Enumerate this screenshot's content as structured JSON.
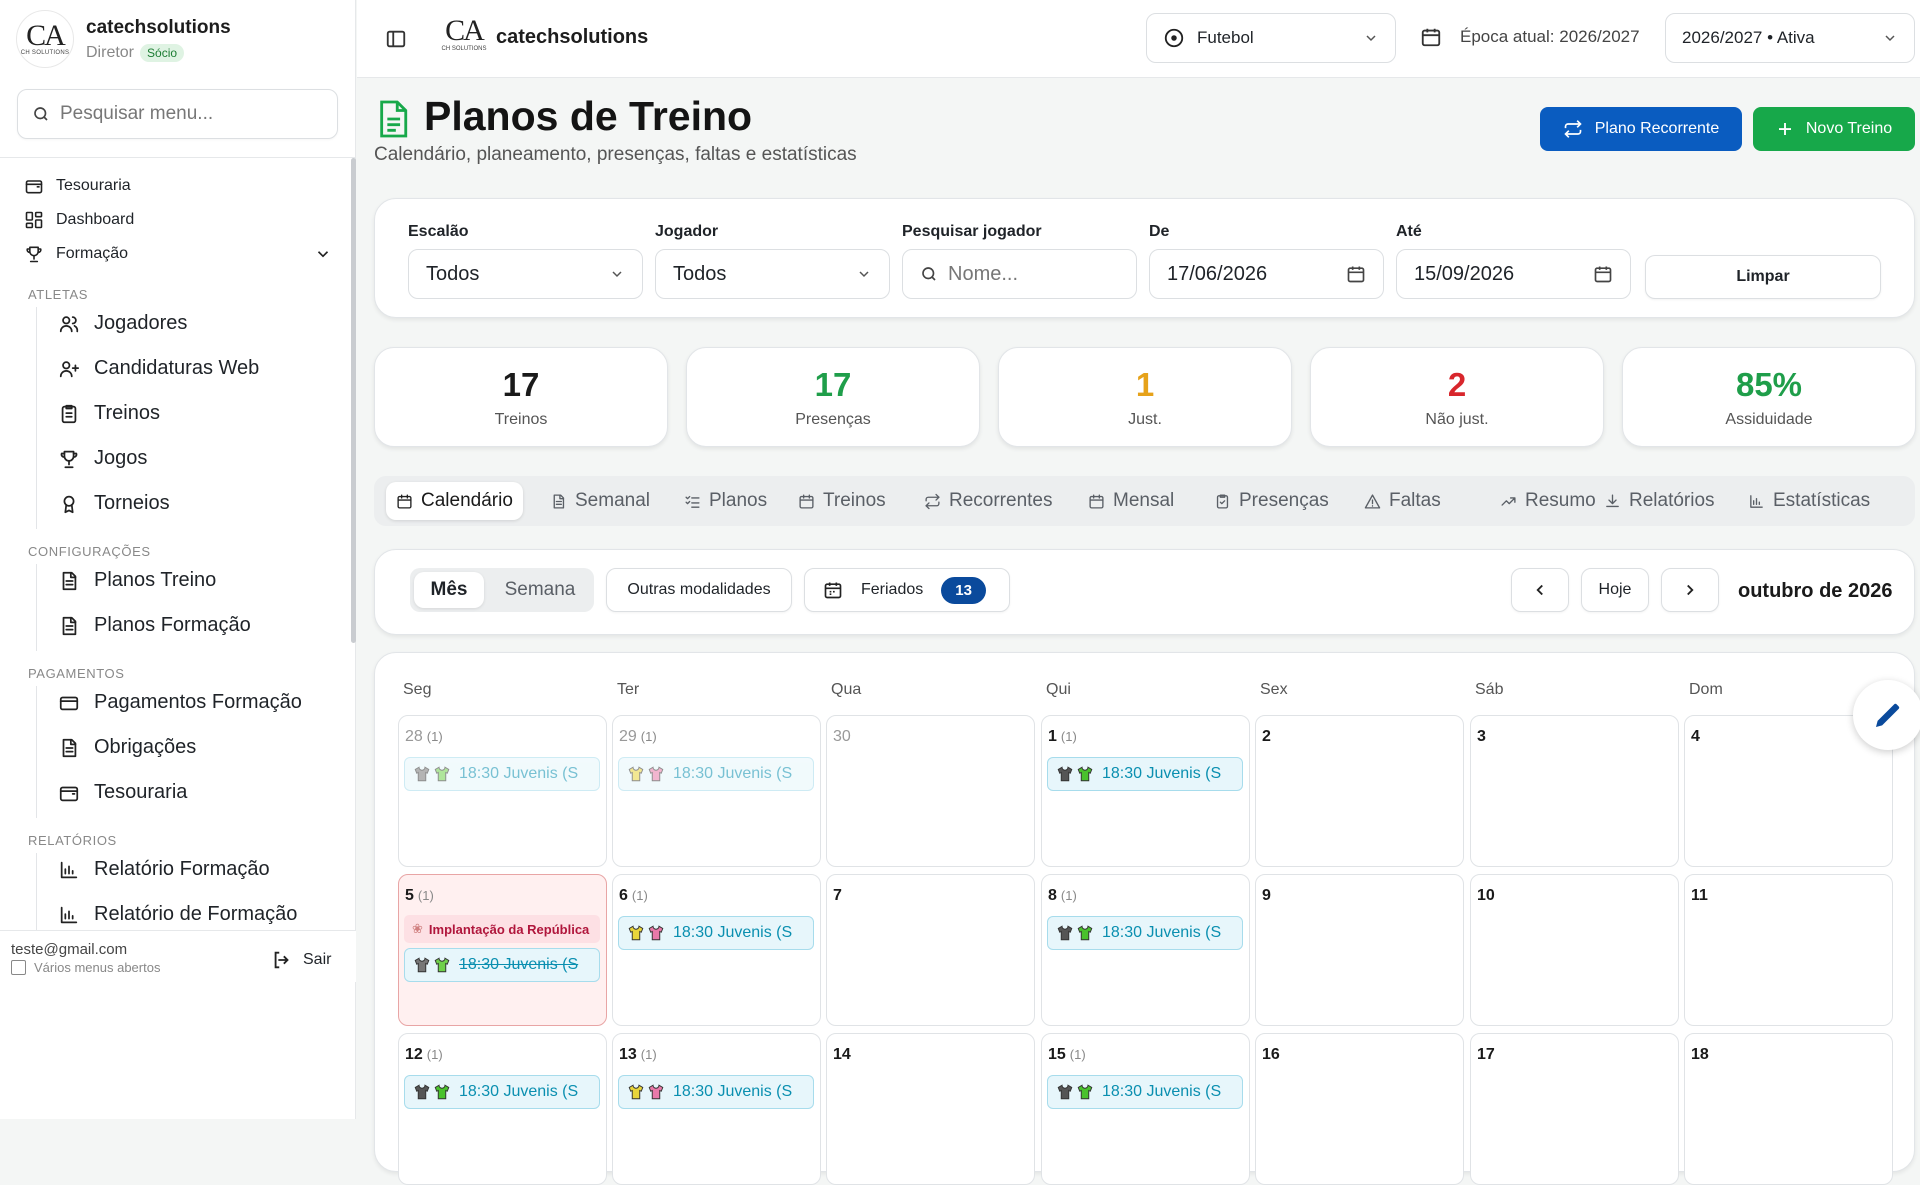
{
  "brand": {
    "name": "catechsolutions",
    "role": "Diretor",
    "badge": "Sócio",
    "logo_text": "CA",
    "logo_sub": "CH SOLUTIONS"
  },
  "sidebar": {
    "search_placeholder": "Pesquisar menu...",
    "top_items": [
      {
        "label": "Tesouraria",
        "icon": "wallet-icon"
      },
      {
        "label": "Dashboard",
        "icon": "dashboard-icon"
      },
      {
        "label": "Formação",
        "icon": "trophy-icon"
      }
    ],
    "sections": [
      {
        "title": "ATLETAS",
        "items": [
          {
            "label": "Jogadores",
            "icon": "users-icon"
          },
          {
            "label": "Candidaturas Web",
            "icon": "user-plus-icon"
          },
          {
            "label": "Treinos",
            "icon": "clipboard-icon"
          },
          {
            "label": "Jogos",
            "icon": "trophy-icon"
          },
          {
            "label": "Torneios",
            "icon": "award-icon"
          }
        ]
      },
      {
        "title": "CONFIGURAÇÕES",
        "items": [
          {
            "label": "Planos Treino",
            "icon": "file-icon"
          },
          {
            "label": "Planos Formação",
            "icon": "file-icon"
          }
        ]
      },
      {
        "title": "PAGAMENTOS",
        "items": [
          {
            "label": "Pagamentos Formação",
            "icon": "credit-card-icon"
          },
          {
            "label": "Obrigações",
            "icon": "file-icon"
          },
          {
            "label": "Tesouraria",
            "icon": "wallet-icon"
          }
        ]
      },
      {
        "title": "RELATÓRIOS",
        "items": [
          {
            "label": "Relatório Formação",
            "icon": "bar-chart-icon"
          },
          {
            "label": "Relatório de Formação",
            "icon": "bar-chart-icon"
          }
        ]
      }
    ],
    "footer": {
      "email": "teste@gmail.com",
      "checkbox_label": "Vários menus abertos",
      "logout": "Sair"
    }
  },
  "topbar": {
    "name": "catechsolutions",
    "sport": "Futebol",
    "epoca_label": "Época atual: 2026/2027",
    "season": "2026/2027 • Ativa"
  },
  "header": {
    "title": "Planos de Treino",
    "subtitle": "Calendário, planeamento, presenças, faltas e estatísticas",
    "btn_recorrente": "Plano Recorrente",
    "btn_novo": "Novo Treino"
  },
  "filters": {
    "escalao_label": "Escalão",
    "escalao_value": "Todos",
    "jogador_label": "Jogador",
    "jogador_value": "Todos",
    "pesquisar_label": "Pesquisar jogador",
    "pesquisar_placeholder": "Nome...",
    "de_label": "De",
    "de_value": "17/06/2026",
    "ate_label": "Até",
    "ate_value": "15/09/2026",
    "limpar": "Limpar"
  },
  "stats": [
    {
      "value": "17",
      "label": "Treinos",
      "color": "#1a1a1a"
    },
    {
      "value": "17",
      "label": "Presenças",
      "color": "#1f9e4a"
    },
    {
      "value": "1",
      "label": "Just.",
      "color": "#e6a21a"
    },
    {
      "value": "2",
      "label": "Não just.",
      "color": "#d8262c"
    },
    {
      "value": "85%",
      "label": "Assiduidade",
      "color": "#1f9e4a"
    }
  ],
  "tabs": [
    {
      "label": "Calendário",
      "icon": "calendar-icon",
      "active": true
    },
    {
      "label": "Semanal",
      "icon": "file-icon"
    },
    {
      "label": "Planos",
      "icon": "list-check-icon"
    },
    {
      "label": "Treinos",
      "icon": "calendar-icon"
    },
    {
      "label": "Recorrentes",
      "icon": "repeat-icon"
    },
    {
      "label": "Mensal",
      "icon": "calendar-icon"
    },
    {
      "label": "Presenças",
      "icon": "clipboard-check-icon"
    },
    {
      "label": "Faltas",
      "icon": "alert-icon"
    },
    {
      "label": "Resumo",
      "icon": "trend-icon"
    },
    {
      "label": "Relatórios",
      "icon": "download-icon"
    },
    {
      "label": "Estatísticas",
      "icon": "bar-chart-icon"
    }
  ],
  "calendar": {
    "view_mes": "Mês",
    "view_semana": "Semana",
    "outras": "Outras modalidades",
    "feriados": "Feriados",
    "feriados_count": "13",
    "hoje": "Hoje",
    "month": "outubro de 2026",
    "weekdays": [
      "Seg",
      "Ter",
      "Qua",
      "Qui",
      "Sex",
      "Sáb",
      "Dom"
    ],
    "days": [
      {
        "d": "28",
        "count": "(1)",
        "out": true,
        "event": {
          "text": "18:30 Juvenis (S",
          "c1": "#777",
          "c2": "#6fd04a"
        }
      },
      {
        "d": "29",
        "count": "(1)",
        "out": true,
        "event": {
          "text": "18:30 Juvenis (S",
          "c1": "#e8d53a",
          "c2": "#e979a9"
        }
      },
      {
        "d": "30",
        "out": true
      },
      {
        "d": "1",
        "count": "(1)",
        "event": {
          "text": "18:30 Juvenis (S",
          "c1": "#555",
          "c2": "#49c22c"
        }
      },
      {
        "d": "2"
      },
      {
        "d": "3"
      },
      {
        "d": "4"
      },
      {
        "d": "5",
        "count": "(1)",
        "holiday": "Implantação da República",
        "event": {
          "text": "18:30 Juvenis (S",
          "c1": "#777",
          "c2": "#6fd04a",
          "strike": true
        }
      },
      {
        "d": "6",
        "count": "(1)",
        "event": {
          "text": "18:30 Juvenis (S",
          "c1": "#e8d53a",
          "c2": "#e979a9"
        }
      },
      {
        "d": "7"
      },
      {
        "d": "8",
        "count": "(1)",
        "event": {
          "text": "18:30 Juvenis (S",
          "c1": "#555",
          "c2": "#49c22c"
        }
      },
      {
        "d": "9"
      },
      {
        "d": "10"
      },
      {
        "d": "11"
      },
      {
        "d": "12",
        "count": "(1)",
        "event": {
          "text": "18:30 Juvenis (S",
          "c1": "#555",
          "c2": "#49c22c"
        }
      },
      {
        "d": "13",
        "count": "(1)",
        "event": {
          "text": "18:30 Juvenis (S",
          "c1": "#e8d53a",
          "c2": "#e979a9"
        }
      },
      {
        "d": "14"
      },
      {
        "d": "15",
        "count": "(1)",
        "event": {
          "text": "18:30 Juvenis (S",
          "c1": "#555",
          "c2": "#49c22c"
        }
      },
      {
        "d": "16"
      },
      {
        "d": "17"
      },
      {
        "d": "18"
      }
    ]
  },
  "colors": {
    "primary": "#0a5cc0",
    "green": "#17a84a",
    "badge_blue": "#0a4a9c"
  }
}
